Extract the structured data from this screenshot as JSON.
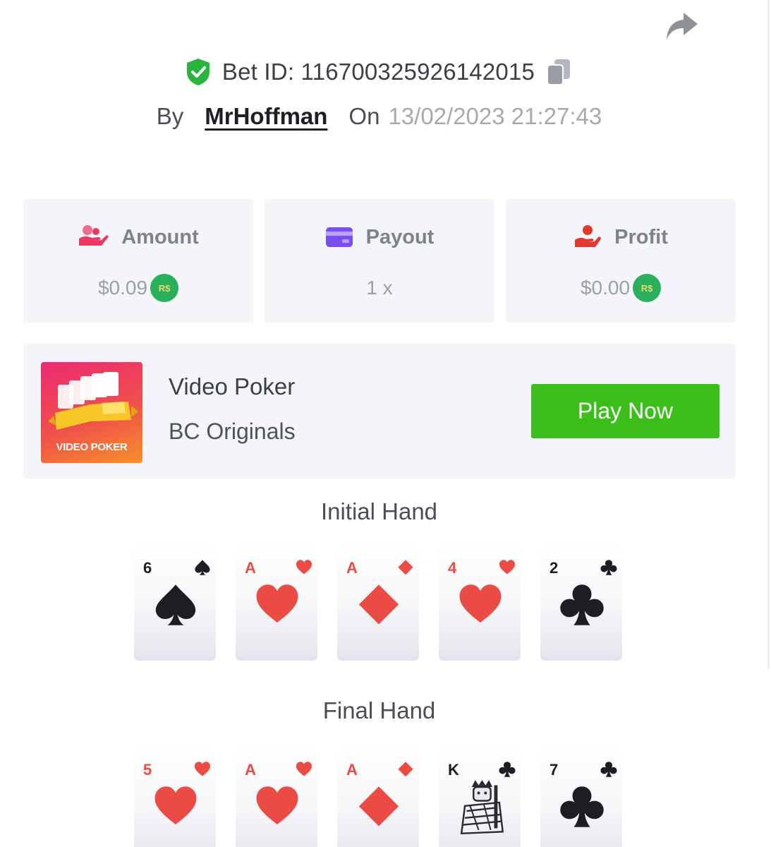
{
  "header": {
    "bet_id_text": "Bet ID: 116700325926142015",
    "by_label": "By",
    "username": "MrHoffman",
    "on_label": "On",
    "datetime": "13/02/2023 21:27:43"
  },
  "stats": [
    {
      "label": "Amount",
      "value": "$0.09",
      "icon": "money-hand-icon",
      "icon_color": "#ea3a62",
      "coin": "R$"
    },
    {
      "label": "Payout",
      "value": "1 x",
      "icon": "wallet-card-icon",
      "icon_color": "#7b4ef2"
    },
    {
      "label": "Profit",
      "value": "$0.00",
      "icon": "coin-hand-icon",
      "icon_color": "#e0392e",
      "coin": "R$"
    }
  ],
  "game": {
    "name": "Video Poker",
    "provider": "BC Originals",
    "thumb_label": "VIDEO POKER",
    "play_label": "Play Now",
    "play_color": "#3cbf1b"
  },
  "initial_hand": {
    "title": "Initial Hand",
    "cards": [
      {
        "rank": "6",
        "suit": "spade",
        "color": "black"
      },
      {
        "rank": "A",
        "suit": "heart",
        "color": "red"
      },
      {
        "rank": "A",
        "suit": "diamond",
        "color": "red"
      },
      {
        "rank": "4",
        "suit": "heart",
        "color": "red"
      },
      {
        "rank": "2",
        "suit": "club",
        "color": "black"
      }
    ]
  },
  "final_hand": {
    "title": "Final Hand",
    "cards": [
      {
        "rank": "5",
        "suit": "heart",
        "color": "red"
      },
      {
        "rank": "A",
        "suit": "heart",
        "color": "red"
      },
      {
        "rank": "A",
        "suit": "diamond",
        "color": "red"
      },
      {
        "rank": "K",
        "suit": "club",
        "color": "black",
        "face": "king"
      },
      {
        "rank": "7",
        "suit": "club",
        "color": "black"
      }
    ]
  }
}
